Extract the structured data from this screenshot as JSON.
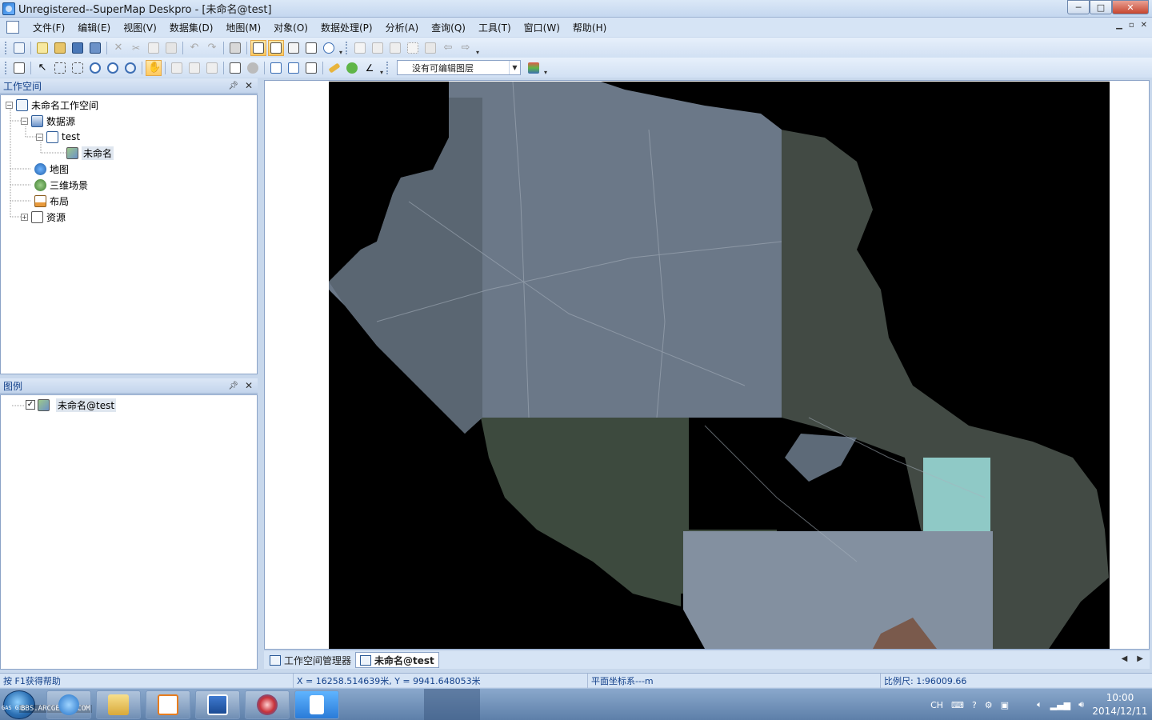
{
  "window": {
    "title": "Unregistered--SuperMap Deskpro - [未命名@test]",
    "controls": {
      "minimize": "─",
      "maximize": "□",
      "close": "✕"
    }
  },
  "menu": [
    {
      "label": "文件(F)"
    },
    {
      "label": "编辑(E)"
    },
    {
      "label": "视图(V)"
    },
    {
      "label": "数据集(D)"
    },
    {
      "label": "地图(M)"
    },
    {
      "label": "对象(O)"
    },
    {
      "label": "数据处理(P)"
    },
    {
      "label": "分析(A)"
    },
    {
      "label": "查询(Q)"
    },
    {
      "label": "工具(T)"
    },
    {
      "label": "窗口(W)"
    },
    {
      "label": "帮助(H)"
    }
  ],
  "toolbar2": {
    "layer_select": "没有可编辑图层"
  },
  "workspace_panel": {
    "title": "工作空间",
    "tree": {
      "root": "未命名工作空间",
      "datasources": "数据源",
      "datasource_test": "test",
      "dataset": "未命名",
      "maps": "地图",
      "scenes": "三维场景",
      "layouts": "布局",
      "resources": "资源"
    }
  },
  "legend_panel": {
    "title": "图例",
    "layer": "未命名@test"
  },
  "doc_tabs": [
    {
      "label": "工作空间管理器"
    },
    {
      "label": "未命名@test"
    }
  ],
  "statusbar": {
    "help": "按 F1获得帮助",
    "coords": "X = 16258.514639米, Y = 9941.648053米",
    "crs": "平面坐标系---m",
    "scale": "比例尺: 1:96009.66"
  },
  "taskbar": {
    "watermark": "BBS.ARCGEYES.COM",
    "start_text": "GAS\nGIS",
    "tray_lang": "CH",
    "clock_time": "10:00",
    "clock_date": "2014/12/11"
  },
  "colors": {
    "title_bg": "#c4d7ef",
    "panel_header_text": "#15428b",
    "map_background": "#000000",
    "imagery_pale": "#6f7d8e",
    "imagery_dark": "#3b4a3e",
    "imagery_cyan": "#8fc9c6",
    "highlight": "#ffc95e"
  }
}
